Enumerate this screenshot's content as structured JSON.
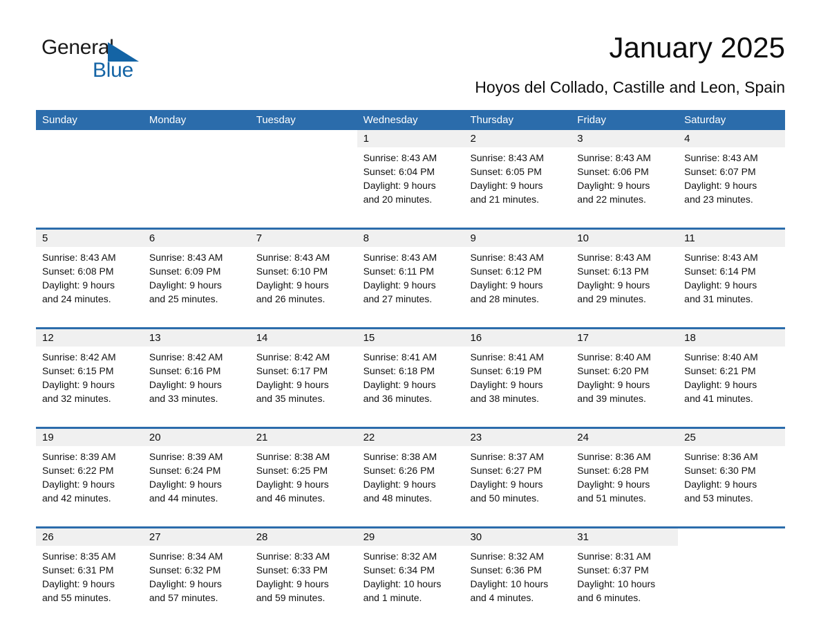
{
  "brand": {
    "name_part1": "General",
    "name_part2": "Blue",
    "logo_icon": "triangle-logo-icon",
    "accent_color": "#1464a5"
  },
  "header": {
    "title": "January 2025",
    "subtitle": "Hoyos del Collado, Castille and Leon, Spain"
  },
  "theme": {
    "header_blue": "#2b6cab",
    "band_gray": "#f0f0f0",
    "text_black": "#0d0d0d"
  },
  "weekdays": [
    "Sunday",
    "Monday",
    "Tuesday",
    "Wednesday",
    "Thursday",
    "Friday",
    "Saturday"
  ],
  "weeks": [
    [
      {
        "day": "",
        "lines": []
      },
      {
        "day": "",
        "lines": []
      },
      {
        "day": "",
        "lines": []
      },
      {
        "day": "1",
        "lines": [
          "Sunrise: 8:43 AM",
          "Sunset: 6:04 PM",
          "Daylight: 9 hours",
          "and 20 minutes."
        ]
      },
      {
        "day": "2",
        "lines": [
          "Sunrise: 8:43 AM",
          "Sunset: 6:05 PM",
          "Daylight: 9 hours",
          "and 21 minutes."
        ]
      },
      {
        "day": "3",
        "lines": [
          "Sunrise: 8:43 AM",
          "Sunset: 6:06 PM",
          "Daylight: 9 hours",
          "and 22 minutes."
        ]
      },
      {
        "day": "4",
        "lines": [
          "Sunrise: 8:43 AM",
          "Sunset: 6:07 PM",
          "Daylight: 9 hours",
          "and 23 minutes."
        ]
      }
    ],
    [
      {
        "day": "5",
        "lines": [
          "Sunrise: 8:43 AM",
          "Sunset: 6:08 PM",
          "Daylight: 9 hours",
          "and 24 minutes."
        ]
      },
      {
        "day": "6",
        "lines": [
          "Sunrise: 8:43 AM",
          "Sunset: 6:09 PM",
          "Daylight: 9 hours",
          "and 25 minutes."
        ]
      },
      {
        "day": "7",
        "lines": [
          "Sunrise: 8:43 AM",
          "Sunset: 6:10 PM",
          "Daylight: 9 hours",
          "and 26 minutes."
        ]
      },
      {
        "day": "8",
        "lines": [
          "Sunrise: 8:43 AM",
          "Sunset: 6:11 PM",
          "Daylight: 9 hours",
          "and 27 minutes."
        ]
      },
      {
        "day": "9",
        "lines": [
          "Sunrise: 8:43 AM",
          "Sunset: 6:12 PM",
          "Daylight: 9 hours",
          "and 28 minutes."
        ]
      },
      {
        "day": "10",
        "lines": [
          "Sunrise: 8:43 AM",
          "Sunset: 6:13 PM",
          "Daylight: 9 hours",
          "and 29 minutes."
        ]
      },
      {
        "day": "11",
        "lines": [
          "Sunrise: 8:43 AM",
          "Sunset: 6:14 PM",
          "Daylight: 9 hours",
          "and 31 minutes."
        ]
      }
    ],
    [
      {
        "day": "12",
        "lines": [
          "Sunrise: 8:42 AM",
          "Sunset: 6:15 PM",
          "Daylight: 9 hours",
          "and 32 minutes."
        ]
      },
      {
        "day": "13",
        "lines": [
          "Sunrise: 8:42 AM",
          "Sunset: 6:16 PM",
          "Daylight: 9 hours",
          "and 33 minutes."
        ]
      },
      {
        "day": "14",
        "lines": [
          "Sunrise: 8:42 AM",
          "Sunset: 6:17 PM",
          "Daylight: 9 hours",
          "and 35 minutes."
        ]
      },
      {
        "day": "15",
        "lines": [
          "Sunrise: 8:41 AM",
          "Sunset: 6:18 PM",
          "Daylight: 9 hours",
          "and 36 minutes."
        ]
      },
      {
        "day": "16",
        "lines": [
          "Sunrise: 8:41 AM",
          "Sunset: 6:19 PM",
          "Daylight: 9 hours",
          "and 38 minutes."
        ]
      },
      {
        "day": "17",
        "lines": [
          "Sunrise: 8:40 AM",
          "Sunset: 6:20 PM",
          "Daylight: 9 hours",
          "and 39 minutes."
        ]
      },
      {
        "day": "18",
        "lines": [
          "Sunrise: 8:40 AM",
          "Sunset: 6:21 PM",
          "Daylight: 9 hours",
          "and 41 minutes."
        ]
      }
    ],
    [
      {
        "day": "19",
        "lines": [
          "Sunrise: 8:39 AM",
          "Sunset: 6:22 PM",
          "Daylight: 9 hours",
          "and 42 minutes."
        ]
      },
      {
        "day": "20",
        "lines": [
          "Sunrise: 8:39 AM",
          "Sunset: 6:24 PM",
          "Daylight: 9 hours",
          "and 44 minutes."
        ]
      },
      {
        "day": "21",
        "lines": [
          "Sunrise: 8:38 AM",
          "Sunset: 6:25 PM",
          "Daylight: 9 hours",
          "and 46 minutes."
        ]
      },
      {
        "day": "22",
        "lines": [
          "Sunrise: 8:38 AM",
          "Sunset: 6:26 PM",
          "Daylight: 9 hours",
          "and 48 minutes."
        ]
      },
      {
        "day": "23",
        "lines": [
          "Sunrise: 8:37 AM",
          "Sunset: 6:27 PM",
          "Daylight: 9 hours",
          "and 50 minutes."
        ]
      },
      {
        "day": "24",
        "lines": [
          "Sunrise: 8:36 AM",
          "Sunset: 6:28 PM",
          "Daylight: 9 hours",
          "and 51 minutes."
        ]
      },
      {
        "day": "25",
        "lines": [
          "Sunrise: 8:36 AM",
          "Sunset: 6:30 PM",
          "Daylight: 9 hours",
          "and 53 minutes."
        ]
      }
    ],
    [
      {
        "day": "26",
        "lines": [
          "Sunrise: 8:35 AM",
          "Sunset: 6:31 PM",
          "Daylight: 9 hours",
          "and 55 minutes."
        ]
      },
      {
        "day": "27",
        "lines": [
          "Sunrise: 8:34 AM",
          "Sunset: 6:32 PM",
          "Daylight: 9 hours",
          "and 57 minutes."
        ]
      },
      {
        "day": "28",
        "lines": [
          "Sunrise: 8:33 AM",
          "Sunset: 6:33 PM",
          "Daylight: 9 hours",
          "and 59 minutes."
        ]
      },
      {
        "day": "29",
        "lines": [
          "Sunrise: 8:32 AM",
          "Sunset: 6:34 PM",
          "Daylight: 10 hours",
          "and 1 minute."
        ]
      },
      {
        "day": "30",
        "lines": [
          "Sunrise: 8:32 AM",
          "Sunset: 6:36 PM",
          "Daylight: 10 hours",
          "and 4 minutes."
        ]
      },
      {
        "day": "31",
        "lines": [
          "Sunrise: 8:31 AM",
          "Sunset: 6:37 PM",
          "Daylight: 10 hours",
          "and 6 minutes."
        ]
      },
      {
        "day": "",
        "lines": []
      }
    ]
  ]
}
